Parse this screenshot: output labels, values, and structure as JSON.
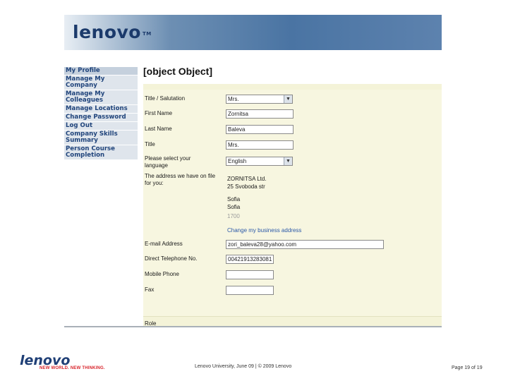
{
  "banner": {
    "logo": "lenovo",
    "tm": "TM"
  },
  "sidebar": {
    "items": [
      {
        "label": "My Profile"
      },
      {
        "label": "Manage My Company"
      },
      {
        "label": "Manage My Colleagues"
      },
      {
        "label": "Manage Locations"
      },
      {
        "label": "Change Password"
      },
      {
        "label": "Log Out"
      },
      {
        "label": "Company Skills Summary"
      },
      {
        "label": "Person Course Completion"
      }
    ]
  },
  "main": {
    "title": {
      "label": "Title",
      "value": "Mrs."
    },
    "title_salutation": {
      "label": "Title / Salutation",
      "value": "Mrs."
    },
    "first_name": {
      "label": "First Name",
      "value": "Zornitsa"
    },
    "last_name": {
      "label": "Last Name",
      "value": "Baleva"
    },
    "language": {
      "label": "Please select your language",
      "value": "English"
    },
    "address": {
      "label": "The address we have on file for you:",
      "line1": "ZORNITSA Ltd.",
      "line2": "25 Svoboda str",
      "line3": "Sofia",
      "line4": "Sofia",
      "line5": "1700",
      "change_link": "Change my business address"
    },
    "email": {
      "label": "E-mail Address",
      "value": "zori_baleva28@yahoo.com"
    },
    "direct_phone": {
      "label": "Direct Telephone No.",
      "value": "00421913283081"
    },
    "mobile": {
      "label": "Mobile Phone",
      "value": ""
    },
    "fax": {
      "label": "Fax",
      "value": ""
    },
    "role_label": "Role"
  },
  "footer": {
    "logo": "lenovo",
    "tagline": "NEW WORLD. NEW THINKING.",
    "center": "Lenovo University, June 09 | © 2009 Lenovo",
    "page": "Page 19 of 19"
  }
}
